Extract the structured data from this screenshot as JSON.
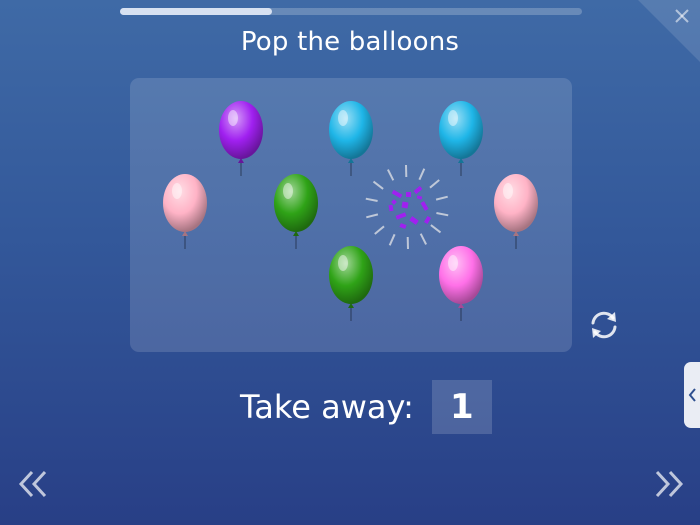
{
  "title": "Pop the balloons",
  "progress": {
    "fraction": 0.33
  },
  "prompt": {
    "label": "Take away:",
    "value": "1"
  },
  "balloons": [
    {
      "color": "#a020f0",
      "popped": false
    },
    {
      "color": "#1fb6e8",
      "popped": false
    },
    {
      "color": "#1fb6e8",
      "popped": false
    },
    {
      "color": "#ffb3c6",
      "popped": false
    },
    {
      "color": "#2fa317",
      "popped": false
    },
    {
      "color": "#a020f0",
      "popped": true
    },
    {
      "color": "#ffb3c6",
      "popped": false
    },
    {
      "color": "#2fa317",
      "popped": false
    },
    {
      "color": "#ff70e8",
      "popped": false
    }
  ],
  "icons": {
    "reset": "refresh-icon",
    "prev": "double-chevron-left-icon",
    "next": "double-chevron-right-icon",
    "close": "close-icon",
    "side_tab": "chevron-left-icon"
  },
  "colors": {
    "background_top": "#3f6aa6",
    "background_bottom": "#283f86",
    "text": "#ffffff"
  }
}
